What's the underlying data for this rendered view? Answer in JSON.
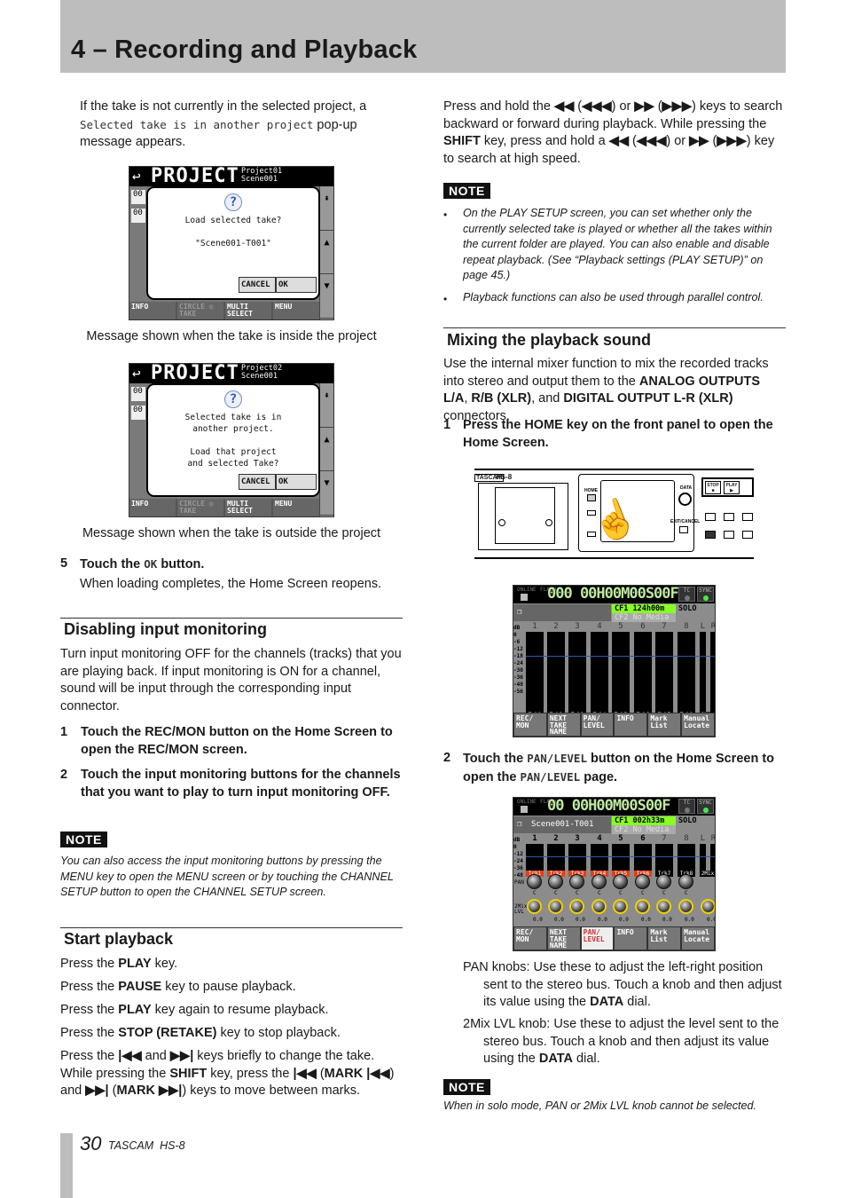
{
  "header": {
    "title": "4 – Recording and Playback"
  },
  "left": {
    "intro": [
      {
        "t": "If the take is not currently in the selected project, a "
      },
      {
        "t": "Selected take is in another project",
        "m": 1
      },
      {
        "t": " pop-up message appears."
      }
    ],
    "screen1": {
      "title": "PROJECT",
      "project": "Project01",
      "scene": "Scene001",
      "lines": [
        "Load selected take?",
        "",
        "\"Scene001-T001\""
      ],
      "cancel": "CANCEL",
      "ok": "OK",
      "side": [
        "00",
        "00"
      ],
      "bar": [
        "INFO",
        "CIRCLE ◎ TAKE",
        "MULTI SELECT",
        "MENU"
      ]
    },
    "caption1": "Message shown when the take is inside the project",
    "screen2": {
      "title": "PROJECT",
      "project": "Project02",
      "scene": "Scene001",
      "lines": [
        "Selected take is in",
        "another project.",
        "",
        "Load that project",
        "and selected Take?"
      ],
      "cancel": "CANCEL",
      "ok": "OK",
      "side": [
        "00",
        "00"
      ],
      "bar": [
        "INFO",
        "CIRCLE ◎ TAKE",
        "MULTI SELECT",
        "MENU"
      ]
    },
    "caption2": "Message shown when the take is outside the project",
    "step5": {
      "num": "5",
      "text": [
        {
          "t": "Touch the "
        },
        {
          "t": "OK",
          "m": 1
        },
        {
          "t": " button."
        }
      ],
      "sub": "When loading completes, the Home Screen reopens."
    },
    "disabling": {
      "heading": "Disabling input monitoring",
      "para": "Turn input monitoring OFF for the channels (tracks) that you are playing back. If input monitoring is ON for a channel, sound will be input through the corresponding input connector.",
      "steps": [
        {
          "num": "1",
          "text": "Touch the REC/MON button on the Home Screen to open the REC/MON screen."
        },
        {
          "num": "2",
          "text": "Touch the input monitoring buttons for the channels that you want to play to turn input monitoring OFF."
        }
      ],
      "note_label": "NOTE",
      "note": "You can also access the input monitoring buttons by pressing the MENU key to open the MENU screen or by touching the CHANNEL SETUP button to open the CHANNEL SETUP screen."
    },
    "start": {
      "heading": "Start playback",
      "lines": [
        [
          {
            "t": "Press the "
          },
          {
            "t": "PLAY",
            "b": 1
          },
          {
            "t": " key."
          }
        ],
        [
          {
            "t": "Press the "
          },
          {
            "t": "PAUSE",
            "b": 1
          },
          {
            "t": " key to pause playback."
          }
        ],
        [
          {
            "t": "Press the "
          },
          {
            "t": "PLAY",
            "b": 1
          },
          {
            "t": " key again to resume playback."
          }
        ],
        [
          {
            "t": "Press the "
          },
          {
            "t": "STOP (RETAKE)",
            "b": 1
          },
          {
            "t": " key to stop playback."
          }
        ],
        [
          {
            "t": "Press the "
          },
          {
            "t": "|◀◀",
            "b": 1
          },
          {
            "t": " and "
          },
          {
            "t": "▶▶|",
            "b": 1
          },
          {
            "t": " keys briefly to change the take. While pressing the "
          },
          {
            "t": "SHIFT",
            "b": 1
          },
          {
            "t": " key, press the "
          },
          {
            "t": "|◀◀",
            "b": 1
          },
          {
            "t": " ("
          },
          {
            "t": "MARK |◀◀",
            "b": 1
          },
          {
            "t": ") and "
          },
          {
            "t": "▶▶|",
            "b": 1
          },
          {
            "t": " ("
          },
          {
            "t": "MARK ▶▶|",
            "b": 1
          },
          {
            "t": ") keys to move between marks."
          }
        ]
      ]
    }
  },
  "right": {
    "intro": [
      {
        "t": "Press and hold the "
      },
      {
        "t": "◀◀",
        "b": 1
      },
      {
        "t": " ("
      },
      {
        "t": "◀◀◀",
        "b": 1
      },
      {
        "t": ") or "
      },
      {
        "t": "▶▶",
        "b": 1
      },
      {
        "t": " ("
      },
      {
        "t": "▶▶▶",
        "b": 1
      },
      {
        "t": ") keys to search backward or forward during playback. While pressing the "
      },
      {
        "t": "SHIFT",
        "b": 1
      },
      {
        "t": " key, press and hold a "
      },
      {
        "t": "◀◀",
        "b": 1
      },
      {
        "t": " ("
      },
      {
        "t": "◀◀◀",
        "b": 1
      },
      {
        "t": ") or "
      },
      {
        "t": "▶▶",
        "b": 1
      },
      {
        "t": " ("
      },
      {
        "t": "▶▶▶",
        "b": 1
      },
      {
        "t": ") key to search at high speed."
      }
    ],
    "note_label": "NOTE",
    "bullets": [
      "On the PLAY SETUP screen, you can set whether only the currently selected take is played or whether all the takes within the current folder are played. You can also enable and disable repeat playback. (See “Playback settings (PLAY SETUP)” on page 45.)",
      "Playback functions can also be used through parallel control."
    ],
    "mixing": {
      "heading": "Mixing the playback sound",
      "para": [
        {
          "t": "Use the internal mixer function to mix the recorded tracks into stereo and output them to the "
        },
        {
          "t": "ANALOG OUTPUTS L/A",
          "b": 1
        },
        {
          "t": ", "
        },
        {
          "t": "R/B (XLR)",
          "b": 1
        },
        {
          "t": ", and "
        },
        {
          "t": "DIGITAL OUTPUT L-R (XLR)",
          "b": 1
        },
        {
          "t": " connectors."
        }
      ],
      "step1": {
        "num": "1",
        "text": "Press the HOME key on the front panel to open the Home Screen."
      },
      "device": {
        "brand": "TASCAM",
        "model": "HS-8",
        "keys": [
          "HOME",
          "STOP ■",
          "PLAY ▶",
          "DATA",
          "EXIT/CANCEL"
        ]
      },
      "home1": {
        "online": "ONLINE",
        "flash": "FLASH",
        "time": "000 00H00M00S00F",
        "tc": "TC",
        "sync": "SYNC",
        "cf1": "CF1 124h00m",
        "cf2": "CF2 No Media",
        "solo": "SOLO",
        "scale": [
          "dB",
          "0",
          "-6",
          "-12",
          "-18",
          "-24",
          "-30",
          "-36",
          "-48",
          "-56"
        ],
        "tracks": [
          "1",
          "2",
          "3",
          "4",
          "5",
          "6",
          "7",
          "8",
          "L",
          "R"
        ],
        "labels": [
          "Trk1",
          "Trk2",
          "Trk3",
          "Trk4",
          "Trk5",
          "Trk6",
          "Trk7",
          "Trk8",
          "2Mix"
        ],
        "buttons": [
          "REC/ MON",
          "NEXT TAKE NAME",
          "PAN/ LEVEL",
          "INFO",
          "Mark List",
          "Manual Locate"
        ]
      },
      "step2": {
        "num": "2",
        "text": [
          {
            "t": "Touch the "
          },
          {
            "t": "PAN/LEVEL",
            "m": 1
          },
          {
            "t": " button on the Home Screen to open the "
          },
          {
            "t": "PAN/LEVEL",
            "m": 1
          },
          {
            "t": " page."
          }
        ]
      },
      "home2": {
        "online": "ONLINE",
        "flash": "FLASH",
        "time": "00 00H00M00S00F",
        "tc": "TC",
        "sync": "SYNC",
        "take": "Scene001-T001",
        "cf1": "CF1 002h33m",
        "cf2": "CF2 No Media",
        "solo": "SOLO",
        "scale": [
          "dB",
          "0",
          "-12",
          "-24",
          "-36",
          "-48"
        ],
        "tracks": [
          "1",
          "2",
          "3",
          "4",
          "5",
          "6",
          "7",
          "8",
          "L",
          "R"
        ],
        "labels": [
          "Trk1",
          "Trk2",
          "Trk3",
          "Trk4",
          "Trk5",
          "Trk6",
          "Trk7",
          "Trk8",
          "2Mix"
        ],
        "armed": [
          true,
          true,
          true,
          true,
          true,
          true,
          false,
          false
        ],
        "pan_label": "PAN",
        "lvl_label": "2Mix LVL",
        "pan_value": "C",
        "lvl_value": "0.0",
        "buttons": [
          "REC/ MON",
          "NEXT TAKE NAME",
          "PAN/ LEVEL",
          "INFO",
          "Mark List",
          "Manual Locate"
        ],
        "active_button": "PAN/ LEVEL"
      },
      "pan_desc": [
        {
          "t": "PAN knobs: Use these to adjust the left-right position sent to the stereo bus. Touch a knob and then adjust its value using the "
        },
        {
          "t": "DATA",
          "b": 1
        },
        {
          "t": " dial."
        }
      ],
      "lvl_desc": [
        {
          "t": "2Mix LVL knob: Use these to adjust the level sent to the stereo bus. Touch a knob and then adjust its value using the "
        },
        {
          "t": "DATA",
          "b": 1
        },
        {
          "t": " dial."
        }
      ],
      "note_label": "NOTE",
      "note": "When in solo mode, PAN or 2Mix LVL knob cannot be selected."
    }
  },
  "footer": {
    "page": "30",
    "product": "TASCAM  HS-8"
  }
}
